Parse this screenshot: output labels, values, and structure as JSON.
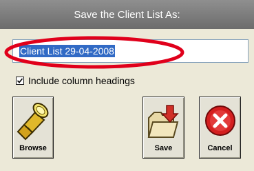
{
  "dialog": {
    "title": "Save the Client List As:"
  },
  "filename": {
    "value": "Client List 29-04-2008"
  },
  "options": {
    "include_headings_label": "Include column headings",
    "include_headings_checked": true
  },
  "buttons": {
    "browse": {
      "label": "Browse",
      "icon": "flashlight-icon"
    },
    "save": {
      "label": "Save",
      "icon": "folder-save-icon"
    },
    "cancel": {
      "label": "Cancel",
      "icon": "cancel-x-icon"
    }
  },
  "colors": {
    "title_bar": "#7a7a7a",
    "selection": "#316ac5",
    "annotation": "#e0001b",
    "cancel_red": "#d41f1f"
  }
}
